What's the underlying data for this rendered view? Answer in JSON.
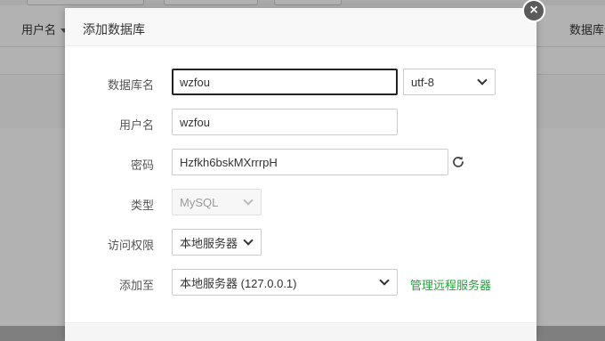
{
  "background": {
    "columns": {
      "username": "用户名",
      "db_location": "数据库位"
    }
  },
  "modal": {
    "title": "添加数据库",
    "fields": {
      "db_name": {
        "label": "数据库名",
        "value": "wzfou"
      },
      "charset": {
        "value": "utf-8"
      },
      "username": {
        "label": "用户名",
        "value": "wzfou"
      },
      "password": {
        "label": "密码",
        "value": "Hzfkh6bskMXrrrpH"
      },
      "type": {
        "label": "类型",
        "value": "MySQL"
      },
      "access": {
        "label": "访问权限",
        "value": "本地服务器"
      },
      "add_to": {
        "label": "添加至",
        "value": "本地服务器 (127.0.0.1)"
      }
    },
    "manage_remote_link": "管理远程服务器"
  },
  "colors": {
    "accent_green": "#20a53a",
    "close_button": "#5b5b5b"
  },
  "icons": {
    "close": "close-icon",
    "refresh": "refresh-icon",
    "dropdown": "chevron-down-icon"
  }
}
